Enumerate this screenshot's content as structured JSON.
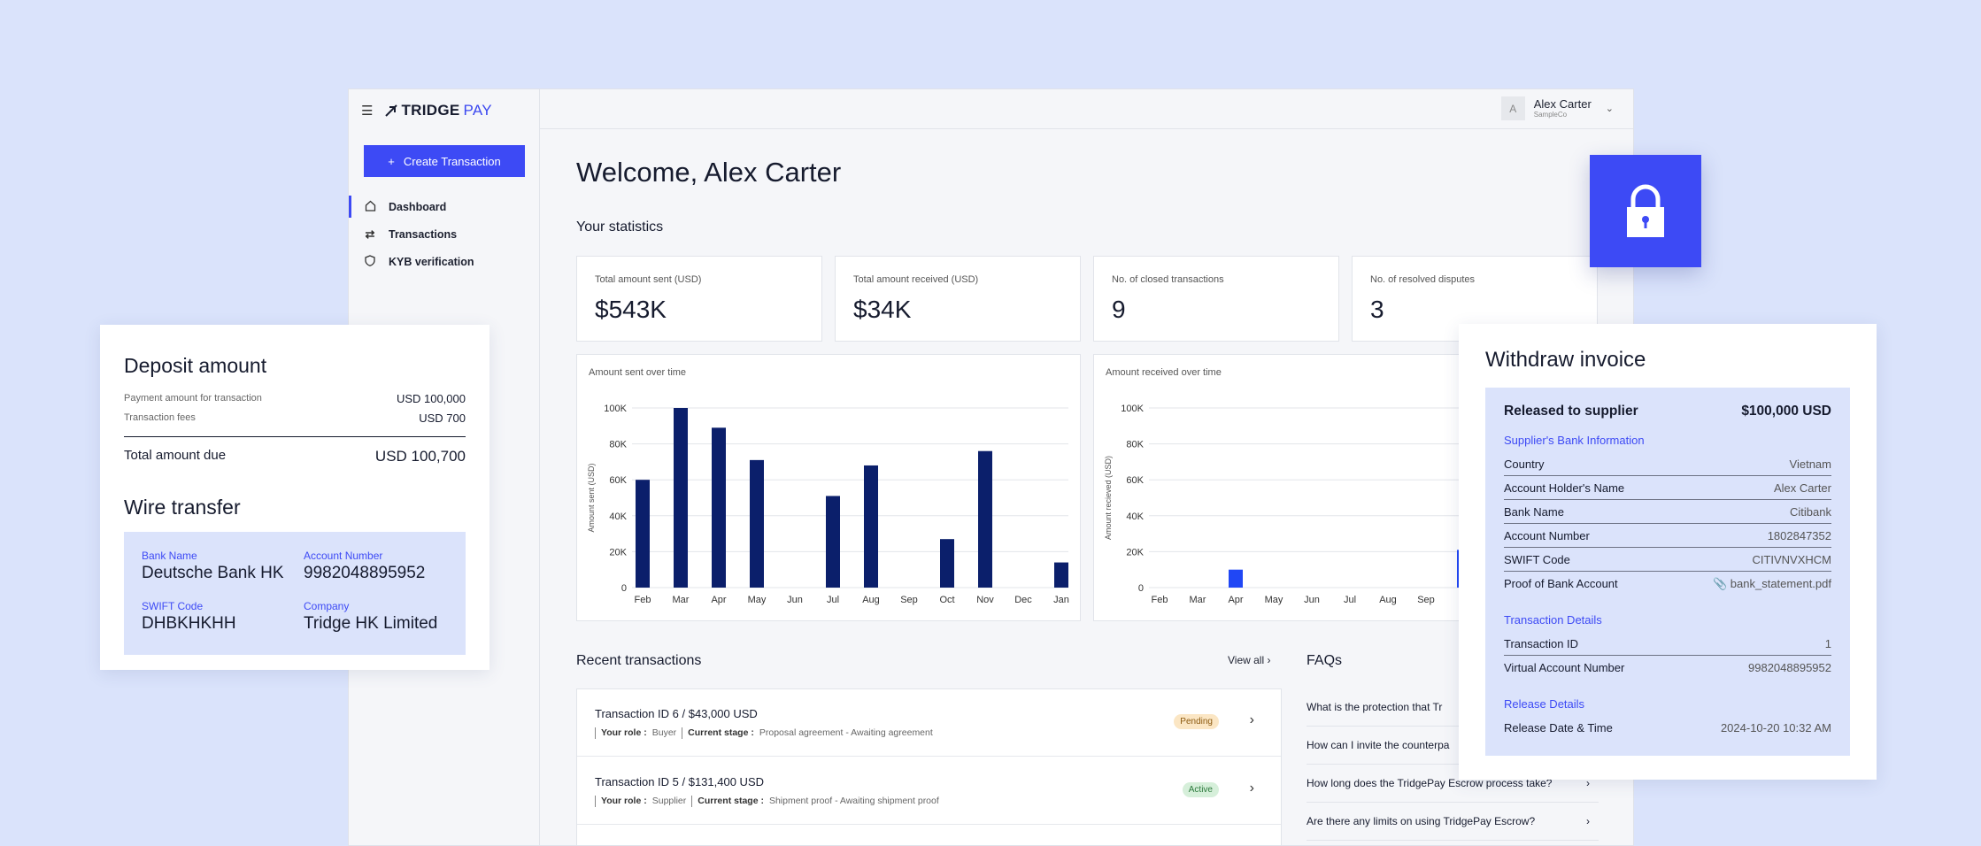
{
  "app": {
    "brand_part1": "TRIDGE",
    "brand_part2": "PAY",
    "create_label": "Create Transaction",
    "nav": [
      {
        "label": "Dashboard"
      },
      {
        "label": "Transactions"
      },
      {
        "label": "KYB verification"
      }
    ],
    "user": {
      "initial": "A",
      "name": "Alex Carter",
      "company": "SampleCo"
    }
  },
  "main": {
    "welcome": "Welcome, Alex Carter",
    "stats_title": "Your statistics",
    "stats": [
      {
        "label": "Total amount sent (USD)",
        "value": "$543K"
      },
      {
        "label": "Total amount received (USD)",
        "value": "$34K"
      },
      {
        "label": "No. of closed transactions",
        "value": "9"
      },
      {
        "label": "No. of resolved disputes",
        "value": "3"
      }
    ],
    "recent_title": "Recent transactions",
    "view_all": "View all",
    "transactions": [
      {
        "title": "Transaction ID 6 / $43,000 USD",
        "role_label": "Your role :",
        "role": "Buyer",
        "stage_label": "Current stage :",
        "stage": "Proposal agreement - Awaiting agreement",
        "status": "Pending"
      },
      {
        "title": "Transaction ID 5 / $131,400 USD",
        "role_label": "Your role :",
        "role": "Supplier",
        "stage_label": "Current stage :",
        "stage": "Shipment proof - Awaiting shipment proof",
        "status": "Active"
      }
    ],
    "faq_title": "FAQs",
    "faqs": [
      "What is the protection that Tr",
      "How can I invite the counterpa",
      "How long does the TridgePay Escrow process take?",
      "Are there any limits on using TridgePay Escrow?"
    ]
  },
  "chart_data": [
    {
      "type": "bar",
      "title": "Amount sent over time",
      "ylabel": "Amount sent (USD)",
      "categories": [
        "Feb",
        "Mar",
        "Apr",
        "May",
        "Jun",
        "Jul",
        "Aug",
        "Sep",
        "Oct",
        "Nov",
        "Dec",
        "Jan"
      ],
      "values": [
        60000,
        100000,
        89000,
        71000,
        0,
        51000,
        68000,
        0,
        27000,
        76000,
        0,
        14000
      ],
      "yticks": [
        "0",
        "20K",
        "40K",
        "60K",
        "80K",
        "100K"
      ],
      "ylim": [
        0,
        100000
      ],
      "color": "#0b1f6b"
    },
    {
      "type": "bar",
      "title": "Amount received over time",
      "ylabel": "Amount recieved (USD)",
      "categories": [
        "Feb",
        "Mar",
        "Apr",
        "May",
        "Jun",
        "Jul",
        "Aug",
        "Sep",
        "O"
      ],
      "values": [
        0,
        0,
        10000,
        0,
        0,
        0,
        0,
        0,
        21000
      ],
      "yticks": [
        "0",
        "20K",
        "40K",
        "60K",
        "80K",
        "100K"
      ],
      "ylim": [
        0,
        100000
      ],
      "color": "#2047f5"
    }
  ],
  "deposit": {
    "title": "Deposit amount",
    "rows": [
      {
        "label": "Payment amount for transaction",
        "value": "USD 100,000"
      },
      {
        "label": "Transaction fees",
        "value": "USD 700"
      }
    ],
    "total_label": "Total amount due",
    "total_value": "USD 100,700",
    "wire_title": "Wire transfer",
    "wire": [
      {
        "label": "Bank Name",
        "value": "Deutsche Bank HK"
      },
      {
        "label": "Account Number",
        "value": "9982048895952"
      },
      {
        "label": "SWIFT Code",
        "value": "DHBKHKHH"
      },
      {
        "label": "Company",
        "value": "Tridge HK Limited"
      }
    ]
  },
  "withdraw": {
    "title": "Withdraw invoice",
    "released_label": "Released to supplier",
    "released_value": "$100,000 USD",
    "bank_section": "Supplier's Bank Information",
    "bank_rows": [
      {
        "label": "Country",
        "value": "Vietnam"
      },
      {
        "label": "Account Holder's Name",
        "value": "Alex Carter"
      },
      {
        "label": "Bank Name",
        "value": "Citibank"
      },
      {
        "label": "Account Number",
        "value": "1802847352"
      },
      {
        "label": "SWIFT Code",
        "value": "CITIVNVXHCM"
      },
      {
        "label": "Proof of Bank Account",
        "value": "bank_statement.pdf"
      }
    ],
    "tx_section": "Transaction Details",
    "tx_rows": [
      {
        "label": "Transaction ID",
        "value": "1"
      },
      {
        "label": "Virtual Account Number",
        "value": "9982048895952"
      }
    ],
    "release_section": "Release Details",
    "release_rows": [
      {
        "label": "Release Date & Time",
        "value": "2024-10-20 10:32 AM"
      }
    ]
  }
}
